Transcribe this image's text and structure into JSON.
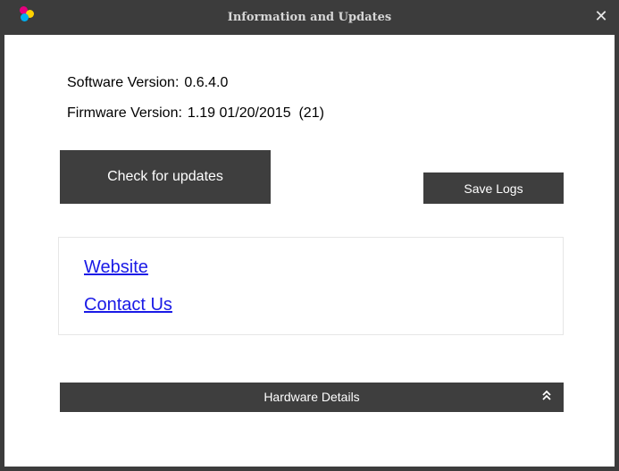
{
  "window": {
    "title": "Information and Updates",
    "close_glyph": "✕",
    "app_icon": {
      "name": "color-dots-icon",
      "colors": [
        "#e6007e",
        "#ffd200",
        "#00aeef"
      ]
    }
  },
  "info": {
    "software_label": "Software Version:",
    "software_value": "0.6.4.0",
    "firmware_label": "Firmware Version:",
    "firmware_value": "1.19 01/20/2015  (21)"
  },
  "buttons": {
    "check_updates": "Check for updates",
    "save_logs": "Save Logs"
  },
  "links": {
    "website": "Website",
    "contact": "Contact Us"
  },
  "hardware": {
    "label": "Hardware Details",
    "chevron_glyph": "˄",
    "chevron_icon": "double-chevron-up-icon"
  }
}
